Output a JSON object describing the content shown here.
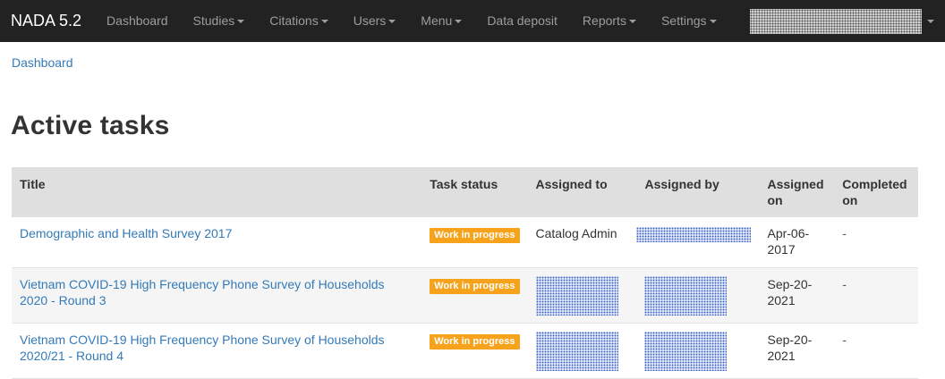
{
  "navbar": {
    "brand": "NADA 5.2",
    "items": [
      {
        "label": "Dashboard",
        "dropdown": false
      },
      {
        "label": "Studies",
        "dropdown": true
      },
      {
        "label": "Citations",
        "dropdown": true
      },
      {
        "label": "Users",
        "dropdown": true
      },
      {
        "label": "Menu",
        "dropdown": true
      },
      {
        "label": "Data deposit",
        "dropdown": false
      },
      {
        "label": "Reports",
        "dropdown": true
      },
      {
        "label": "Settings",
        "dropdown": true
      }
    ]
  },
  "breadcrumb": "Dashboard",
  "page_title": "Active tasks",
  "table": {
    "headers": [
      "Title",
      "Task status",
      "Assigned to",
      "Assigned by",
      "Assigned on",
      "Completed on"
    ],
    "rows": [
      {
        "title": "Demographic and Health Survey 2017",
        "status": "Work in progress",
        "assigned_to": "Catalog Admin",
        "assigned_on": "Apr-06-2017",
        "completed_on": "-"
      },
      {
        "title": "Vietnam COVID-19 High Frequency Phone Survey of Households 2020 - Round 3",
        "status": "Work in progress",
        "assigned_to": "",
        "assigned_on": "Sep-20-2021",
        "completed_on": "-"
      },
      {
        "title": "Vietnam COVID-19 High Frequency Phone Survey of Households 2020/21 - Round 4",
        "status": "Work in progress",
        "assigned_to": "",
        "assigned_on": "Sep-20-2021",
        "completed_on": "-"
      }
    ]
  },
  "colors": {
    "navbar_bg": "#222222",
    "link": "#337ab7",
    "badge": "#f7a21b",
    "header_bg": "#dfdfdf"
  }
}
